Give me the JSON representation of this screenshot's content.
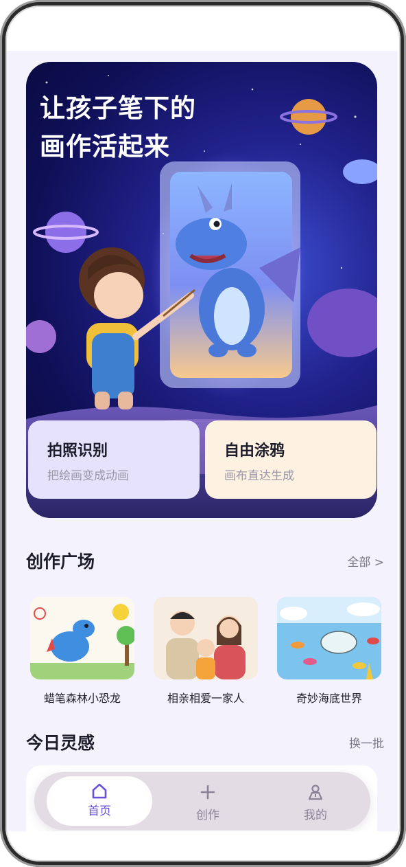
{
  "hero": {
    "title_line1": "让孩子笔下的",
    "title_line2": "画作活起来"
  },
  "cards": [
    {
      "title": "拍照识别",
      "subtitle": "把绘画变成动画"
    },
    {
      "title": "自由涂鸦",
      "subtitle": "画布直达生成"
    }
  ],
  "plaza": {
    "title": "创作广场",
    "more": "全部 >",
    "items": [
      {
        "caption": "蜡笔森林小恐龙"
      },
      {
        "caption": "相亲相爱一家人"
      },
      {
        "caption": "奇妙海底世界"
      }
    ]
  },
  "inspiration": {
    "title": "今日灵感",
    "refresh": "换一批"
  },
  "tabbar": {
    "items": [
      {
        "label": "首页",
        "icon": "home-icon"
      },
      {
        "label": "创作",
        "icon": "plus-icon"
      },
      {
        "label": "我的",
        "icon": "profile-icon"
      }
    ]
  },
  "colors": {
    "accent": "#6a4fd8",
    "background": "#f4f2fd",
    "card_photo": "#e6e2fc",
    "card_doodle": "#fdf1e2"
  }
}
